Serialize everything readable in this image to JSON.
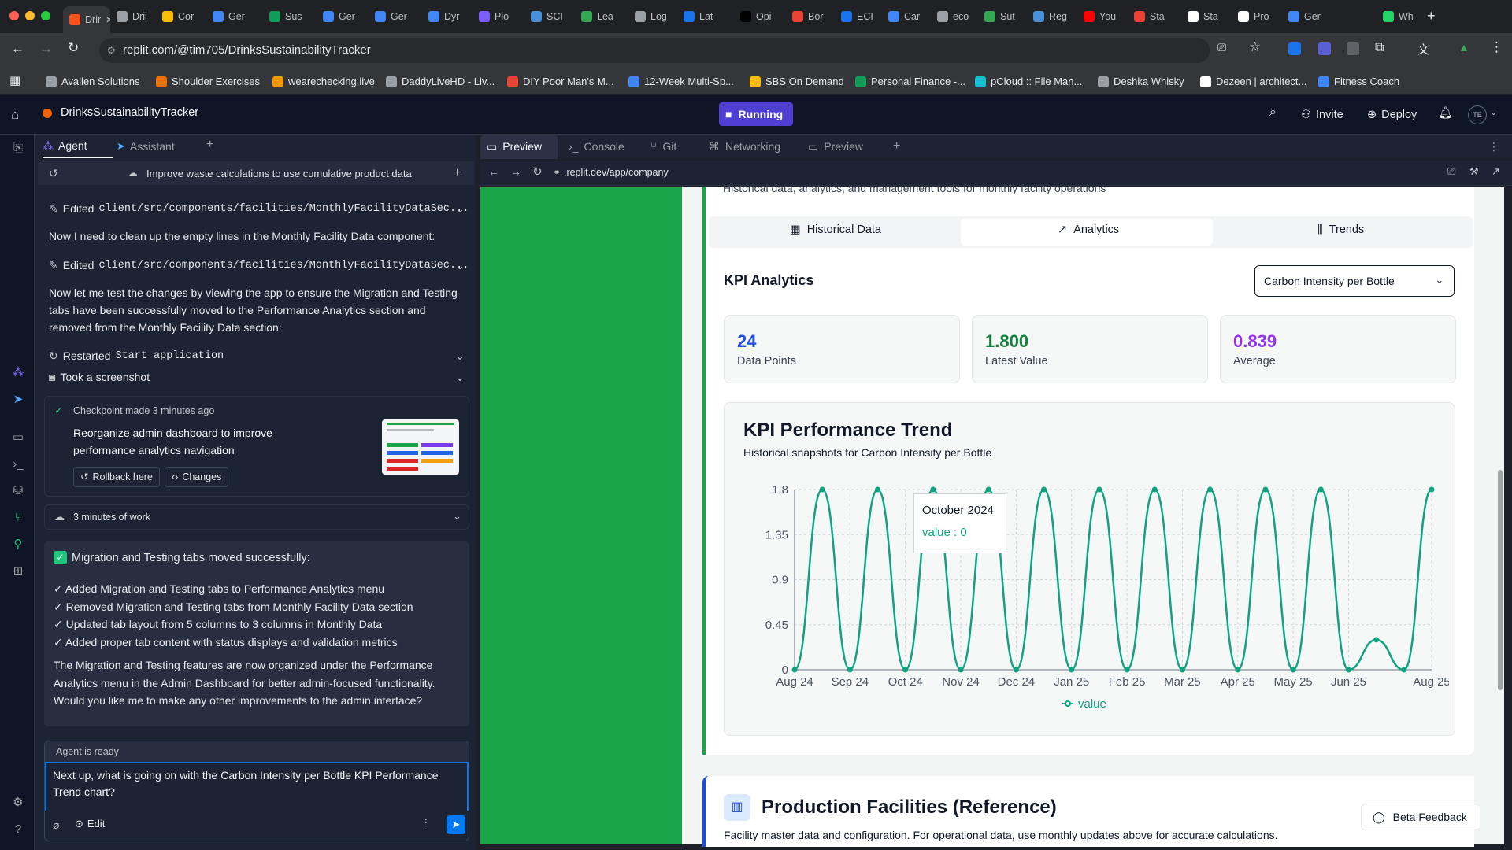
{
  "browser": {
    "tabs": [
      {
        "label": "Drir",
        "color": "#f6531f"
      },
      {
        "label": "Drii",
        "color": "#9aa0a6"
      },
      {
        "label": "Cor",
        "color": "#fbbc04"
      },
      {
        "label": "Ger",
        "color": "#4285f4"
      },
      {
        "label": "Sus",
        "color": "#0f9d58"
      },
      {
        "label": "Ger",
        "color": "#4285f4"
      },
      {
        "label": "Ger",
        "color": "#4285f4"
      },
      {
        "label": "Dyr",
        "color": "#4285f4"
      },
      {
        "label": "Pio",
        "color": "#7c5cfc"
      },
      {
        "label": "SCI",
        "color": "#4a90d9"
      },
      {
        "label": "Lea",
        "color": "#34a853"
      },
      {
        "label": "Log",
        "color": "#9aa0a6"
      },
      {
        "label": "Lat",
        "color": "#1a73e8"
      },
      {
        "label": "Opi",
        "color": "#000000"
      },
      {
        "label": "Bor",
        "color": "#ea4335"
      },
      {
        "label": "ECI",
        "color": "#1a73e8"
      },
      {
        "label": "Car",
        "color": "#4285f4"
      },
      {
        "label": "eco",
        "color": "#9aa0a6"
      },
      {
        "label": "Sut",
        "color": "#34a853"
      },
      {
        "label": "Reg",
        "color": "#4a90d9"
      },
      {
        "label": "You",
        "color": "#ff0000"
      },
      {
        "label": "Sta",
        "color": "#ea4335"
      },
      {
        "label": "Sta",
        "color": "#ffffff"
      },
      {
        "label": "Pro",
        "color": "#ffffff"
      },
      {
        "label": "Ger",
        "color": "#4285f4"
      },
      {
        "label": "Wh",
        "color": "#25d366"
      }
    ],
    "url": "replit.com/@tim705/DrinksSustainabilityTracker",
    "bookmarks": [
      {
        "label": "Avallen Solutions",
        "color": "#9aa0a6"
      },
      {
        "label": "Shoulder Exercises",
        "color": "#e8710a"
      },
      {
        "label": "wearechecking.live",
        "color": "#f29900"
      },
      {
        "label": "DaddyLiveHD - Liv...",
        "color": "#9aa0a6"
      },
      {
        "label": "DIY Poor Man's M...",
        "color": "#ea4335"
      },
      {
        "label": "12-Week Multi-Sp...",
        "color": "#4285f4"
      },
      {
        "label": "SBS On Demand",
        "color": "#fbbc04"
      },
      {
        "label": "Personal Finance -...",
        "color": "#0f9d58"
      },
      {
        "label": "pCloud :: File Man...",
        "color": "#17bed0"
      },
      {
        "label": "Deshka Whisky",
        "color": "#9aa0a6"
      },
      {
        "label": "Dezeen | architect...",
        "color": "#ffffff"
      },
      {
        "label": "Fitness Coach",
        "color": "#4285f4"
      }
    ]
  },
  "replit": {
    "project_name": "DrinksSustainabilityTracker",
    "run_status": "Running",
    "invite_label": "Invite",
    "deploy_label": "Deploy",
    "avatar_initials": "TE"
  },
  "agent": {
    "tabs": [
      "Agent",
      "Assistant"
    ],
    "thread_title": "Improve waste calculations to use cumulative product data",
    "edit1_prefix": "Edited",
    "edit1_path": "client/src/components/facilities/MonthlyFacilityDataSec...",
    "msg1": "Now I need to clean up the empty lines in the Monthly Facility Data component:",
    "edit2_prefix": "Edited",
    "edit2_path": "client/src/components/facilities/MonthlyFacilityDataSec...",
    "msg2": "Now let me test the changes by viewing the app to ensure the Migration and Testing tabs have been successfully moved to the Performance Analytics section and removed from the Monthly Facility Data section:",
    "restart_prefix": "Restarted",
    "restart_name": "Start application",
    "screenshot_label": "Took a screenshot",
    "checkpoint_meta": "Checkpoint made 3 minutes ago",
    "checkpoint_title": "Reorganize admin dashboard to improve performance analytics navigation",
    "rollback_label": "Rollback here",
    "changes_label": "Changes",
    "work_label": "3 minutes of work",
    "result_title": "Migration and Testing tabs moved successfully:",
    "result_items": [
      "✓ Added Migration and Testing tabs to Performance Analytics menu",
      "✓ Removed Migration and Testing tabs from Monthly Facility Data section",
      "✓ Updated tab layout from 5 columns to 3 columns in Monthly Data",
      "✓ Added proper tab content with status displays and validation metrics"
    ],
    "result_summary": "The Migration and Testing features are now organized under the Performance Analytics menu in the Admin Dashboard for better admin-focused functionality. Would you like me to make any other improvements to the admin interface?",
    "status": "Agent is ready",
    "input_value": "Next up, what is going on with the Carbon Intensity per Bottle KPI Performance Trend chart?",
    "edit_label": "Edit"
  },
  "workspace": {
    "tabs": [
      "Preview",
      "Console",
      "Git",
      "Networking",
      "Preview"
    ],
    "preview_url": ".replit.dev/app/company"
  },
  "app": {
    "header_sub": "Historical data, analytics, and management tools for monthly facility operations",
    "tabs": [
      "Historical Data",
      "Analytics",
      "Trends"
    ],
    "kpi_heading": "KPI Analytics",
    "select_value": "Carbon Intensity per Bottle",
    "stats": [
      {
        "value": "24",
        "label": "Data Points",
        "color": "#1d4ed8"
      },
      {
        "value": "1.800",
        "label": "Latest Value",
        "color": "#15803d"
      },
      {
        "value": "0.839",
        "label": "Average",
        "color": "#9333ea"
      }
    ],
    "chart_title": "KPI Performance Trend",
    "chart_subtitle": "Historical snapshots for Carbon Intensity per Bottle",
    "tooltip_title": "October 2024",
    "tooltip_value": "value : 0",
    "facilities_title": "Production Facilities (Reference)",
    "facilities_sub": "Facility master data and configuration. For operational data, use monthly updates above for accurate calculations.",
    "beta_feedback": "Beta Feedback"
  },
  "chart_data": {
    "type": "line",
    "x_tick_labels": [
      "Aug 24",
      "Sep 24",
      "Oct 24",
      "Nov 24",
      "Dec 24",
      "Jan 25",
      "Feb 25",
      "Mar 25",
      "Apr 25",
      "May 25",
      "Jun 25",
      "Aug 25"
    ],
    "x": [
      "Aug 24",
      "",
      "Sep 24",
      "",
      "Oct 24",
      "",
      "Nov 24",
      "",
      "Dec 24",
      "",
      "Jan 25",
      "",
      "Feb 25",
      "",
      "Mar 25",
      "",
      "Apr 25",
      "",
      "May 25",
      "",
      "Jun 25",
      "",
      "",
      "Aug 25"
    ],
    "series": [
      {
        "name": "value",
        "color": "#10a37f",
        "values": [
          0,
          1.8,
          0,
          1.8,
          0,
          1.8,
          0,
          1.8,
          0,
          1.8,
          0,
          1.8,
          0,
          1.8,
          0,
          1.8,
          0,
          1.8,
          0,
          1.8,
          0,
          0.3,
          0,
          1.8
        ]
      }
    ],
    "y_ticks": [
      0,
      0.45,
      0.9,
      1.35,
      1.8
    ],
    "ylim": [
      0,
      1.8
    ],
    "grid": true,
    "legend": "bottom"
  }
}
